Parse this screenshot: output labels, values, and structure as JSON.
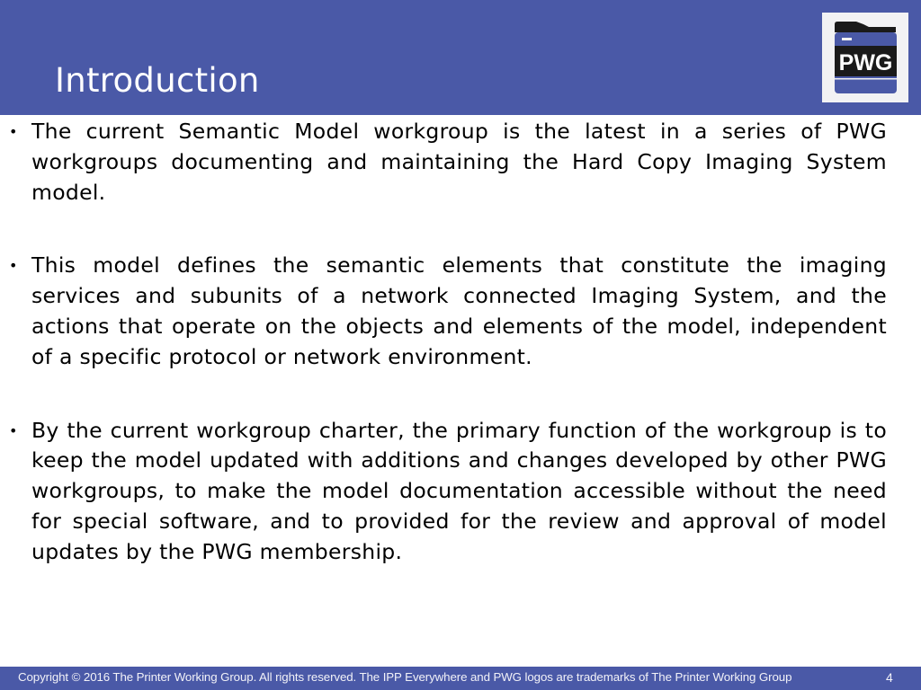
{
  "slide": {
    "title": "Introduction",
    "logo": {
      "text": "PWG",
      "icon": "pwg-printer-logo"
    },
    "bullets": [
      {
        "text": "The current Semantic Model workgroup is the latest in a series of PWG workgroups documenting and maintaining the Hard Copy Imaging System model."
      },
      {
        "text": "This model defines the semantic elements that constitute the imaging services and subunits of a network connected Imaging System, and the actions that operate on the objects and elements of the model, independent of a specific protocol or network environment."
      },
      {
        "text": "By the current workgroup charter, the primary function of the workgroup is to keep the model updated with additions and changes developed by other PWG workgroups, to make the model documentation accessible without the need for special software, and to provided for the review and approval of model updates by the PWG membership."
      }
    ],
    "bullet_glyph": "•"
  },
  "footer": {
    "copyright": "Copyright © 2016 The Printer Working Group. All rights reserved. The IPP Everywhere and PWG logos are trademarks of The Printer Working Group",
    "page_number": "4"
  },
  "colors": {
    "brand_blue": "#4a59a7",
    "logo_bg": "#f2f2f4",
    "logo_dark": "#1a1a1a",
    "text": "#000000"
  }
}
